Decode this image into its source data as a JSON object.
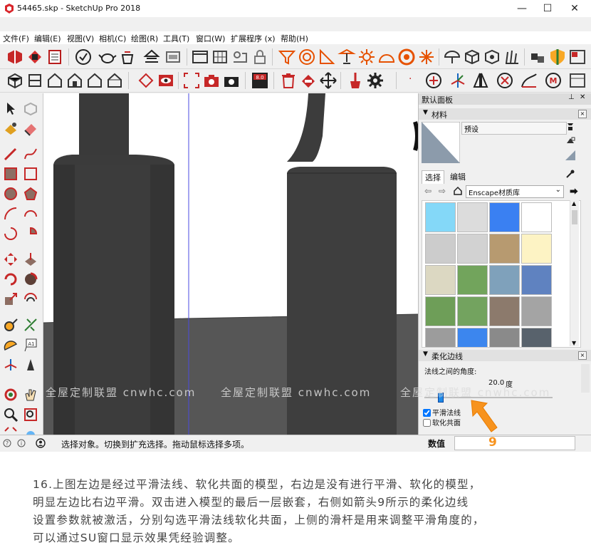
{
  "window": {
    "title": "54465.skp - SketchUp Pro 2018",
    "minimize": "—",
    "maximize": "☐",
    "close": "✕"
  },
  "menu": [
    "文件(F)",
    "编辑(E)",
    "视图(V)",
    "相机(C)",
    "绘图(R)",
    "工具(T)",
    "窗口(W)",
    "扩展程序 (x)",
    "帮助(H)"
  ],
  "panel": {
    "tray_title": "默认面板",
    "materials": {
      "section_title": "材料",
      "preset_name": "预设",
      "tab_select": "选择",
      "tab_edit": "编辑",
      "library": "Enscape材质库",
      "swatch_colors": [
        "#84d8f8",
        "#dcdcdc",
        "#3a80f2",
        "#ffffff",
        "#cccccc",
        "#d2d2d2",
        "#b79a70",
        "#fdf3c4",
        "#dcd8c2",
        "#72a45c",
        "#7fa1bb",
        "#5f82c0",
        "#6e9e58",
        "#73a35f",
        "#8c7a6c",
        "#a4a4a4",
        "#9c9c9c",
        "#3c86ee",
        "#8a8a8a",
        "#58626c"
      ]
    },
    "soften": {
      "section_title": "柔化边线",
      "angle_label": "法线之间的角度:",
      "angle_value": "20.0",
      "angle_unit": "度",
      "slider_fraction": 0.11,
      "smooth_label": "平滑法线",
      "smooth_checked": true,
      "coplanar_label": "软化共面",
      "coplanar_checked": false
    }
  },
  "status": {
    "message": "选择对象。切换到扩充选择。拖动鼠标选择多项。",
    "measure_label": "数值",
    "measure_value": ""
  },
  "annotation": {
    "number": "9"
  },
  "watermark": "全屋定制联盟 cnwhc.com",
  "caption": [
    "16.上图左边是经过平滑法线、软化共面的模型，右边是没有进行平滑、软化的模型，",
    "明显左边比右边平滑。双击进入模型的最后一层嵌套，右侧如箭头9所示的柔化边线",
    "设置参数就被激活，分别勾选平滑法线软化共面，上侧的滑杆是用来调整平滑角度的，",
    "可以通过SU窗口显示效果凭经验调整。"
  ]
}
